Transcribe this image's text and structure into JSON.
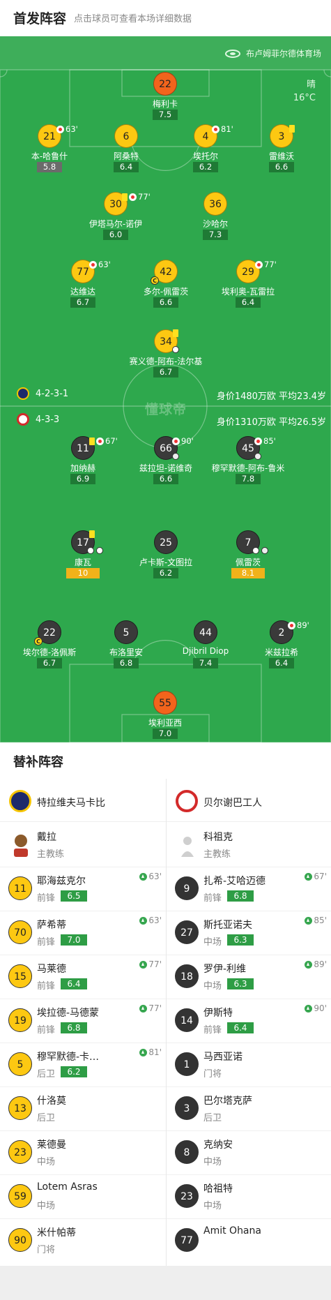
{
  "header": {
    "title": "首发阵容",
    "subtitle": "点击球员可查看本场详细数据"
  },
  "pitch": {
    "stadium": "布卢姆菲尔德体育场",
    "weather": {
      "condition": "晴",
      "temp": "16°C"
    },
    "watermark": "懂球帝",
    "home": {
      "formation": "4-2-3-1",
      "value": "身价1480万欧 平均23.4岁",
      "logo_color": "#1d2a6b"
    },
    "away": {
      "formation": "4-3-3",
      "value": "身价1310万欧 平均26.5岁",
      "logo_color": "#d32a2a"
    },
    "colors": {
      "pitch": "#2ea84d",
      "home": "#fdc812",
      "away": "#3a3a3a",
      "keeper": "#f2641c"
    }
  },
  "home_players": [
    {
      "num": "22",
      "name": "梅利卡",
      "rating": "7.5"
    },
    {
      "num": "21",
      "name": "本-哈鲁什",
      "rating": "5.8",
      "event": "63'"
    },
    {
      "num": "6",
      "name": "阿桑特",
      "rating": "6.4"
    },
    {
      "num": "4",
      "name": "埃托尔",
      "rating": "6.2",
      "event": "81'"
    },
    {
      "num": "3",
      "name": "雷维沃",
      "rating": "6.6"
    },
    {
      "num": "30",
      "name": "伊塔马尔-诺伊",
      "rating": "6.0",
      "event": "77'"
    },
    {
      "num": "36",
      "name": "沙哈尔",
      "rating": "7.3"
    },
    {
      "num": "77",
      "name": "达维达",
      "rating": "6.7",
      "event": "63'"
    },
    {
      "num": "42",
      "name": "多尔-佩雷茨",
      "rating": "6.6",
      "badge": "C"
    },
    {
      "num": "29",
      "name": "埃利奥-瓦雷拉",
      "rating": "6.4",
      "event": "77'"
    },
    {
      "num": "34",
      "name": "赛义德-阿布-法尔基",
      "rating": "6.7"
    }
  ],
  "away_players": [
    {
      "num": "11",
      "name": "加纳赫",
      "rating": "6.9",
      "event": "67'"
    },
    {
      "num": "66",
      "name": "兹拉坦-诺维奇",
      "rating": "6.6",
      "event": "90'"
    },
    {
      "num": "45",
      "name": "穆罕默德-阿布-鲁米",
      "rating": "7.8",
      "event": "85'"
    },
    {
      "num": "17",
      "name": "康瓦",
      "rating": "10"
    },
    {
      "num": "25",
      "name": "卢卡斯-文图拉",
      "rating": "6.2"
    },
    {
      "num": "7",
      "name": "佩雷茨",
      "rating": "8.1"
    },
    {
      "num": "22",
      "name": "埃尔德-洛佩斯",
      "rating": "6.7",
      "badge": "C"
    },
    {
      "num": "5",
      "name": "布洛里安",
      "rating": "6.8"
    },
    {
      "num": "44",
      "name": "Djibril Diop",
      "rating": "7.4"
    },
    {
      "num": "2",
      "name": "米兹拉希",
      "rating": "6.4",
      "event": "89'"
    },
    {
      "num": "55",
      "name": "埃利亚西",
      "rating": "7.0"
    }
  ],
  "bench": {
    "title": "替补阵容",
    "home": {
      "team": "特拉维夫马卡比",
      "logo_color": "#1d2a6b",
      "coach": {
        "name": "戴拉",
        "role": "主教练"
      },
      "subs": [
        {
          "num": "11",
          "name": "耶海兹克尔",
          "pos": "前锋",
          "rating": "6.5",
          "min": "63'"
        },
        {
          "num": "70",
          "name": "萨希蒂",
          "pos": "前锋",
          "rating": "7.0",
          "min": "63'"
        },
        {
          "num": "15",
          "name": "马莱德",
          "pos": "前锋",
          "rating": "6.4",
          "min": "77'"
        },
        {
          "num": "19",
          "name": "埃拉德-马德蒙",
          "pos": "前锋",
          "rating": "6.8",
          "min": "77'"
        },
        {
          "num": "5",
          "name": "穆罕默德-卡…",
          "pos": "后卫",
          "rating": "6.2",
          "min": "81'"
        },
        {
          "num": "13",
          "name": "什洛莫",
          "pos": "后卫"
        },
        {
          "num": "23",
          "name": "莱德曼",
          "pos": "中场"
        },
        {
          "num": "59",
          "name": "Lotem Asras",
          "pos": "中场"
        },
        {
          "num": "90",
          "name": "米什帕蒂",
          "pos": "门将"
        }
      ]
    },
    "away": {
      "team": "贝尔谢巴工人",
      "logo_color": "#d32a2a",
      "coach": {
        "name": "科祖克",
        "role": "主教练"
      },
      "subs": [
        {
          "num": "9",
          "name": "扎希-艾哈迈德",
          "pos": "前锋",
          "rating": "6.8",
          "min": "67'"
        },
        {
          "num": "27",
          "name": "斯托亚诺夫",
          "pos": "中场",
          "rating": "6.3",
          "min": "85'"
        },
        {
          "num": "18",
          "name": "罗伊-利维",
          "pos": "中场",
          "rating": "6.3",
          "min": "89'"
        },
        {
          "num": "14",
          "name": "伊斯特",
          "pos": "前锋",
          "rating": "6.4",
          "min": "90'"
        },
        {
          "num": "1",
          "name": "马西亚诺",
          "pos": "门将"
        },
        {
          "num": "3",
          "name": "巴尔塔克萨",
          "pos": "后卫"
        },
        {
          "num": "8",
          "name": "克纳安",
          "pos": "中场"
        },
        {
          "num": "23",
          "name": "哈祖特",
          "pos": "中场"
        },
        {
          "num": "77",
          "name": "Amit Ohana",
          "pos": ""
        }
      ]
    }
  }
}
